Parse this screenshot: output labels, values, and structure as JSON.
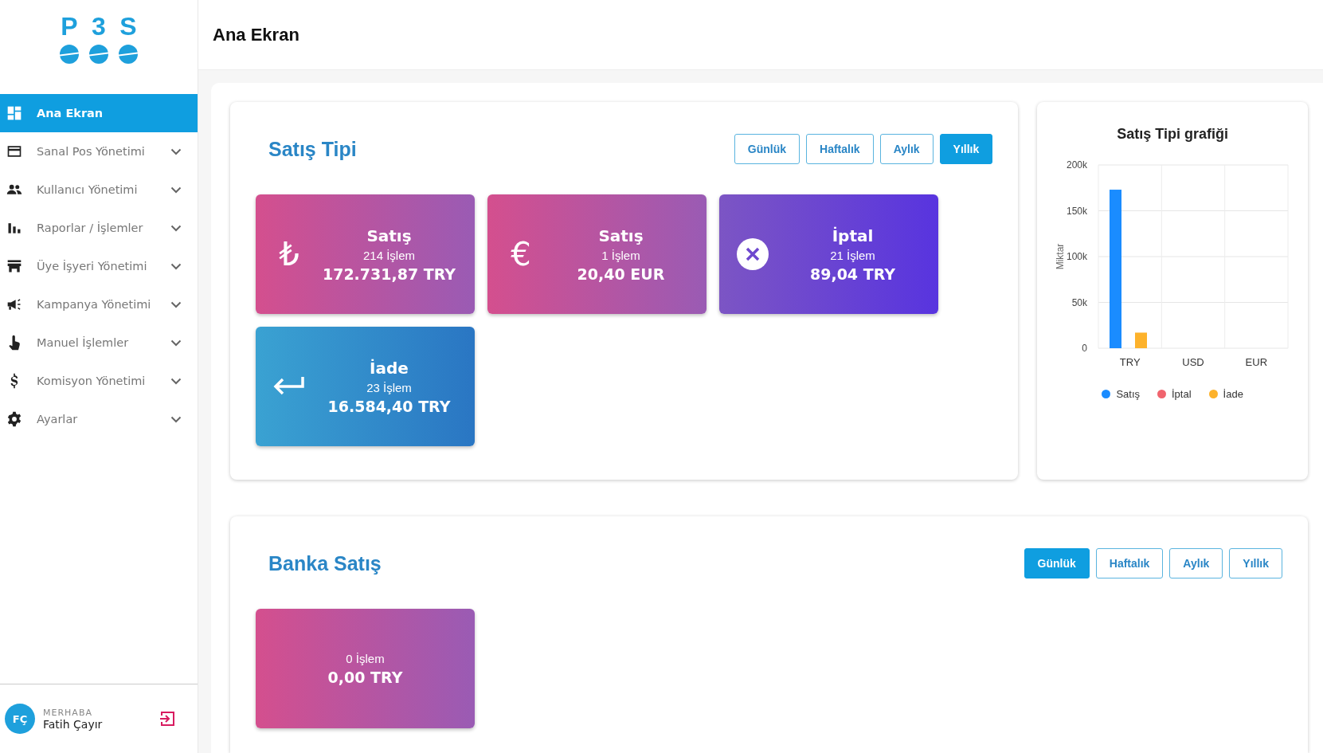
{
  "logo": [
    "P",
    "3",
    "S"
  ],
  "sidebar": {
    "items": [
      {
        "label": "Ana Ekran",
        "selected": true,
        "expandable": false
      },
      {
        "label": "Sanal Pos Yönetimi",
        "selected": false,
        "expandable": true
      },
      {
        "label": "Kullanıcı Yönetimi",
        "selected": false,
        "expandable": true
      },
      {
        "label": "Raporlar / İşlemler",
        "selected": false,
        "expandable": true
      },
      {
        "label": "Üye İşyeri Yönetimi",
        "selected": false,
        "expandable": true
      },
      {
        "label": "Kampanya Yönetimi",
        "selected": false,
        "expandable": true
      },
      {
        "label": "Manuel İşlemler",
        "selected": false,
        "expandable": true
      },
      {
        "label": "Komisyon Yönetimi",
        "selected": false,
        "expandable": true
      },
      {
        "label": "Ayarlar",
        "selected": false,
        "expandable": true
      }
    ]
  },
  "user": {
    "initials": "FÇ",
    "greeting": "MERHABA",
    "name": "Fatih Çayır"
  },
  "header": {
    "title": "Ana Ekran"
  },
  "sales_type": {
    "title": "Satış Tipi",
    "periods": [
      {
        "label": "Günlük",
        "selected": false
      },
      {
        "label": "Haftalık",
        "selected": false
      },
      {
        "label": "Aylık",
        "selected": false
      },
      {
        "label": "Yıllık",
        "selected": true
      }
    ],
    "tiles": [
      {
        "kind": "sale",
        "symbol": "₺",
        "title": "Satış",
        "count": "214 İşlem",
        "amount": "172.731,87 TRY"
      },
      {
        "kind": "sale",
        "symbol": "€",
        "title": "Satış",
        "count": "1 İşlem",
        "amount": "20,40 EUR"
      },
      {
        "kind": "cancel",
        "title": "İptal",
        "count": "21 İşlem",
        "amount": "89,04 TRY"
      },
      {
        "kind": "refund",
        "title": "İade",
        "count": "23 İşlem",
        "amount": "16.584,40 TRY"
      }
    ]
  },
  "chart_card": {
    "chart_data": {
      "type": "bar",
      "title": "Satış Tipi grafiği",
      "ylabel": "Miktar",
      "categories": [
        "TRY",
        "USD",
        "EUR"
      ],
      "series": [
        {
          "name": "Satış",
          "color": "#1a8cff",
          "values": [
            173000,
            0,
            0
          ]
        },
        {
          "name": "İptal",
          "color": "#f0646e",
          "values": [
            0,
            0,
            0
          ]
        },
        {
          "name": "İade",
          "color": "#fdb22b",
          "values": [
            17000,
            0,
            0
          ]
        }
      ],
      "ylim": [
        0,
        200000
      ],
      "grid": true,
      "yticks": [
        {
          "value": 0,
          "label": "0"
        },
        {
          "value": 50000,
          "label": "50k"
        },
        {
          "value": 100000,
          "label": "100k"
        },
        {
          "value": 150000,
          "label": "150k"
        },
        {
          "value": 200000,
          "label": "200k"
        }
      ]
    }
  },
  "bank_sales": {
    "title": "Banka Satış",
    "periods": [
      {
        "label": "Günlük",
        "selected": true
      },
      {
        "label": "Haftalık",
        "selected": false
      },
      {
        "label": "Aylık",
        "selected": false
      },
      {
        "label": "Yıllık",
        "selected": false
      }
    ],
    "tiles": [
      {
        "kind": "sale",
        "count": "0 İşlem",
        "amount": "0,00 TRY"
      }
    ]
  }
}
